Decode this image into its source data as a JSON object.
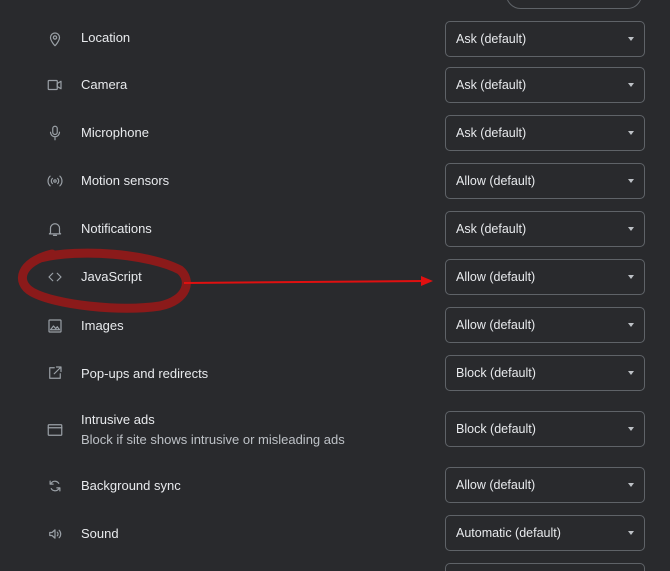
{
  "rows": [
    {
      "label": "Location",
      "icon": "location-pin-icon",
      "value": "Ask (default)"
    },
    {
      "label": "Camera",
      "icon": "camera-icon",
      "value": "Ask (default)"
    },
    {
      "label": "Microphone",
      "icon": "microphone-icon",
      "value": "Ask (default)"
    },
    {
      "label": "Motion sensors",
      "icon": "motion-sensors-icon",
      "value": "Allow (default)"
    },
    {
      "label": "Notifications",
      "icon": "bell-icon",
      "value": "Ask (default)"
    },
    {
      "label": "JavaScript",
      "icon": "code-icon",
      "value": "Allow (default)"
    },
    {
      "label": "Images",
      "icon": "image-icon",
      "value": "Allow (default)"
    },
    {
      "label": "Pop-ups and redirects",
      "icon": "open-in-new-icon",
      "value": "Block (default)"
    },
    {
      "label": "Intrusive ads",
      "sublabel": "Block if site shows intrusive or misleading ads",
      "icon": "ad-window-icon",
      "value": "Block (default)"
    },
    {
      "label": "Background sync",
      "icon": "sync-icon",
      "value": "Allow (default)"
    },
    {
      "label": "Sound",
      "icon": "speaker-icon",
      "value": "Automatic (default)"
    }
  ],
  "colors": {
    "background": "#292a2d",
    "text": "#e8eaed",
    "icon": "#9aa0a6",
    "select_border": "#5f6368",
    "annotation_circle": "#8b1a1a",
    "annotation_arrow": "#e01010"
  }
}
